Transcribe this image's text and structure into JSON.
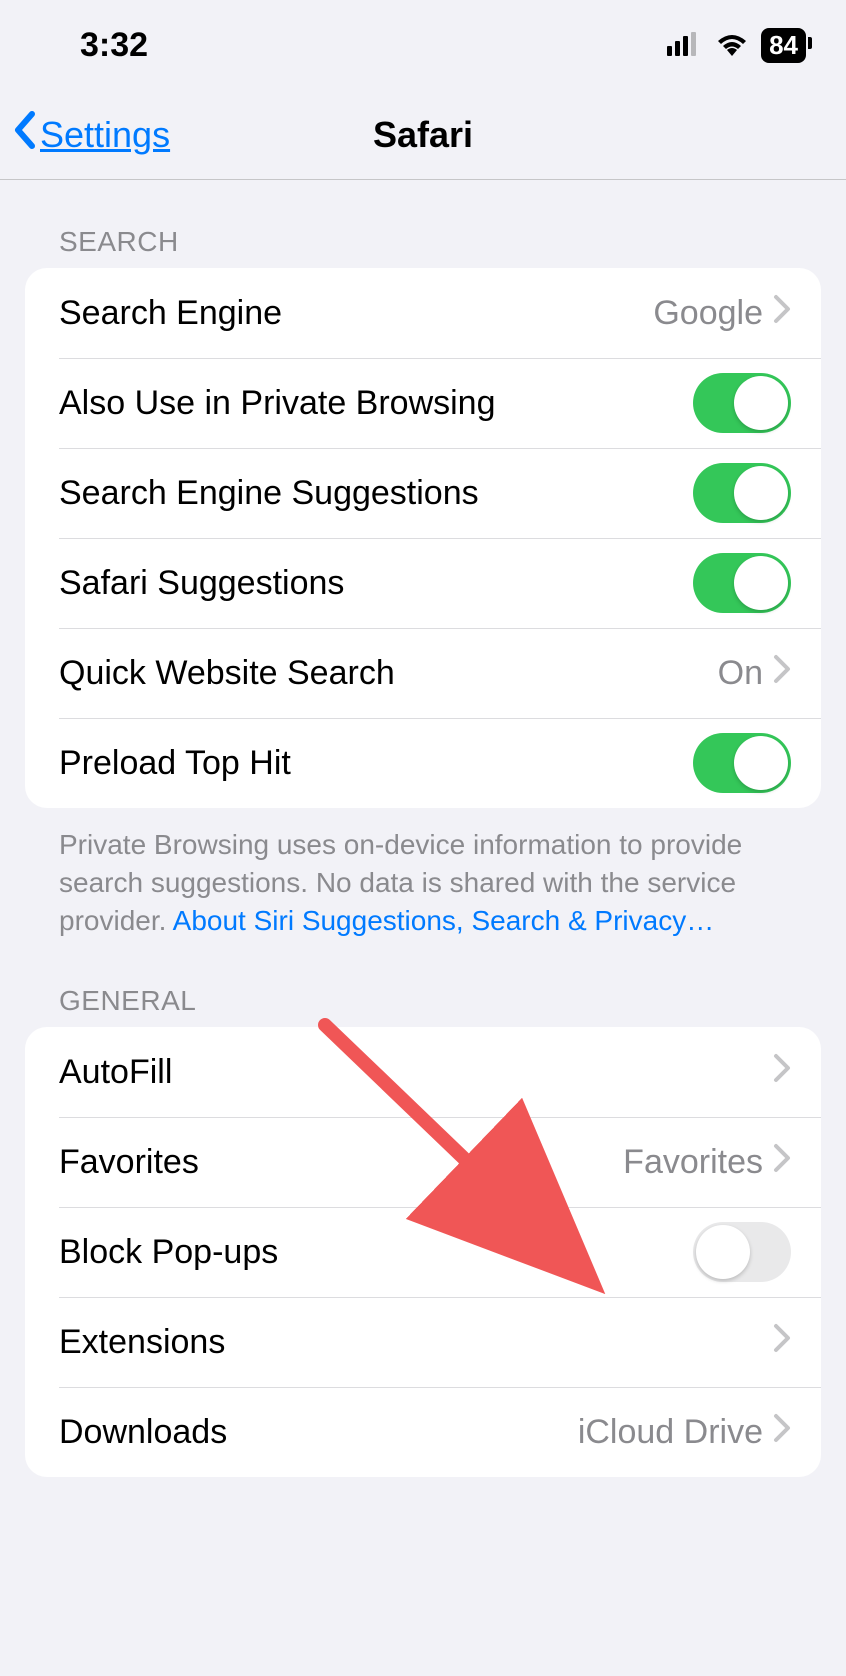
{
  "status": {
    "time": "3:32",
    "battery": "84"
  },
  "nav": {
    "back": "Settings",
    "title": "Safari"
  },
  "sections": {
    "search": {
      "header": "SEARCH",
      "rows": {
        "search_engine": {
          "label": "Search Engine",
          "value": "Google"
        },
        "private_browsing": {
          "label": "Also Use in Private Browsing",
          "on": true
        },
        "engine_suggestions": {
          "label": "Search Engine Suggestions",
          "on": true
        },
        "safari_suggestions": {
          "label": "Safari Suggestions",
          "on": true
        },
        "quick_website": {
          "label": "Quick Website Search",
          "value": "On"
        },
        "preload": {
          "label": "Preload Top Hit",
          "on": true
        }
      },
      "footer_text": "Private Browsing uses on-device information to provide search suggestions. No data is shared with the service provider. ",
      "footer_link": "About Siri Suggestions, Search & Privacy…"
    },
    "general": {
      "header": "GENERAL",
      "rows": {
        "autofill": {
          "label": "AutoFill"
        },
        "favorites": {
          "label": "Favorites",
          "value": "Favorites"
        },
        "block_popups": {
          "label": "Block Pop-ups",
          "on": false
        },
        "extensions": {
          "label": "Extensions"
        },
        "downloads": {
          "label": "Downloads",
          "value": "iCloud Drive"
        }
      }
    }
  }
}
